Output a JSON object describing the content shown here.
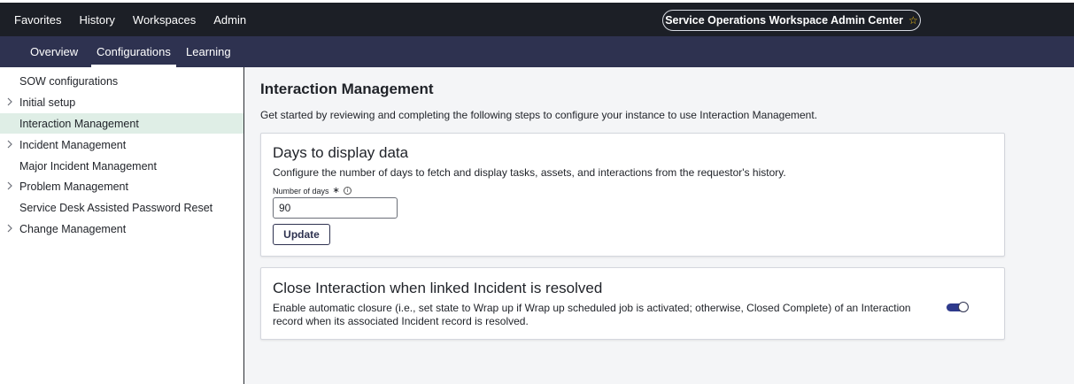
{
  "topnav": {
    "items": [
      "Favorites",
      "History",
      "Workspaces",
      "Admin"
    ],
    "app_title": "Service Operations Workspace Admin Center",
    "favorite_icon": "star-icon",
    "colors": {
      "background": "#1c1f26",
      "star": "#f5c518"
    }
  },
  "subnav": {
    "tabs": [
      "Overview",
      "Configurations",
      "Learning"
    ],
    "active_tab": "Configurations",
    "colors": {
      "background": "#2e3250"
    }
  },
  "sidebar": {
    "items": [
      {
        "label": "SOW configurations",
        "expandable": false,
        "selected": false
      },
      {
        "label": "Initial setup",
        "expandable": true,
        "selected": false
      },
      {
        "label": "Interaction Management",
        "expandable": false,
        "selected": true
      },
      {
        "label": "Incident Management",
        "expandable": true,
        "selected": false
      },
      {
        "label": "Major Incident Management",
        "expandable": false,
        "selected": false
      },
      {
        "label": "Problem Management",
        "expandable": true,
        "selected": false
      },
      {
        "label": "Service Desk Assisted Password Reset",
        "expandable": false,
        "selected": false
      },
      {
        "label": "Change Management",
        "expandable": true,
        "selected": false
      }
    ],
    "colors": {
      "selected_background": "#dfeee6"
    }
  },
  "main": {
    "title": "Interaction Management",
    "description": "Get started by reviewing and completing the following steps to configure your instance to use Interaction Management.",
    "days_card": {
      "title": "Days to display data",
      "description": "Configure the number of days to fetch and display tasks, assets, and interactions from the requestor's history.",
      "field_label": "Number of days",
      "required_mark": "∗",
      "info_icon": "info-icon",
      "value": "90",
      "button_label": "Update"
    },
    "close_card": {
      "title": "Close Interaction when linked Incident is resolved",
      "description_line1": "Enable automatic closure (i.e., set state to Wrap up if Wrap up scheduled job is activated; otherwise, Closed Complete) of an Interaction",
      "description_line2": "record when its associated Incident record is resolved.",
      "toggle_on": true,
      "toggle_color": "#2e3a8c"
    }
  }
}
